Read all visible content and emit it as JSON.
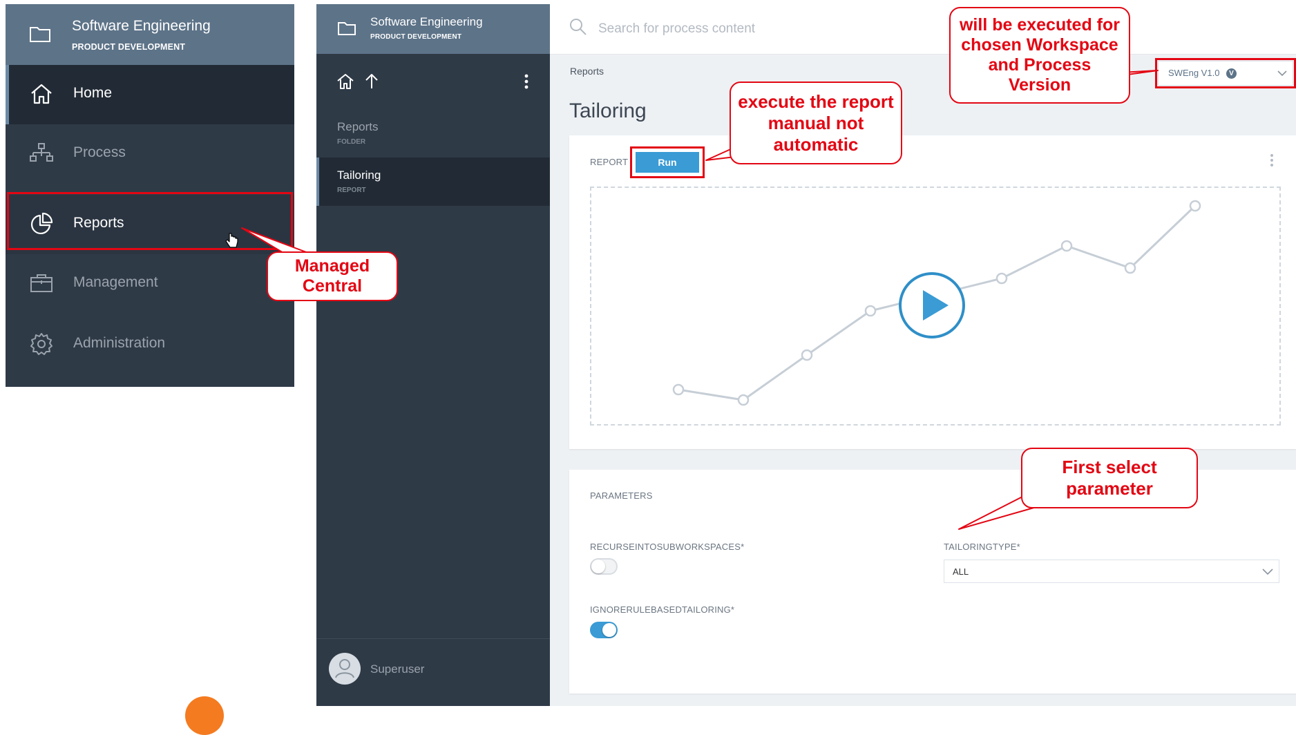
{
  "workspace": {
    "title": "Software Engineering",
    "subtitle": "PRODUCT DEVELOPMENT"
  },
  "nav": {
    "items": [
      {
        "label": "Home",
        "icon": "home-icon"
      },
      {
        "label": "Process",
        "icon": "process-icon"
      },
      {
        "label": "Reports",
        "icon": "reports-icon"
      },
      {
        "label": "Management",
        "icon": "briefcase-icon"
      },
      {
        "label": "Administration",
        "icon": "gear-icon"
      }
    ]
  },
  "tree": {
    "items": [
      {
        "title": "Reports",
        "type": "FOLDER"
      },
      {
        "title": "Tailoring",
        "type": "REPORT"
      }
    ],
    "user": "Superuser"
  },
  "search": {
    "placeholder": "Search for process content"
  },
  "breadcrumb": "Reports",
  "page_title": "Tailoring",
  "version": {
    "label": "SWEng V1.0",
    "badge": "V"
  },
  "report": {
    "label": "REPORT",
    "run_label": "Run"
  },
  "parameters": {
    "label": "PARAMETERS",
    "recurse_label": "RECURSEINTOSUBWORKSPACES*",
    "recurse_on": false,
    "ignore_label": "IGNORERULEBASEDTAILORING*",
    "ignore_on": true,
    "tailoring_type_label": "TAILORINGTYPE*",
    "tailoring_type_value": "ALL"
  },
  "callouts": {
    "managed": "Managed\nCentral",
    "execute": "execute the report\nmanual not\nautomatic",
    "workspace": "will be executed for\nchosen Workspace\nand Process\nVersion",
    "parameter": "First select\nparameter"
  },
  "colors": {
    "accent": "#3a9bd5",
    "highlight": "#e30613",
    "sidebar": "#2f3a47",
    "header": "#5d7388"
  }
}
